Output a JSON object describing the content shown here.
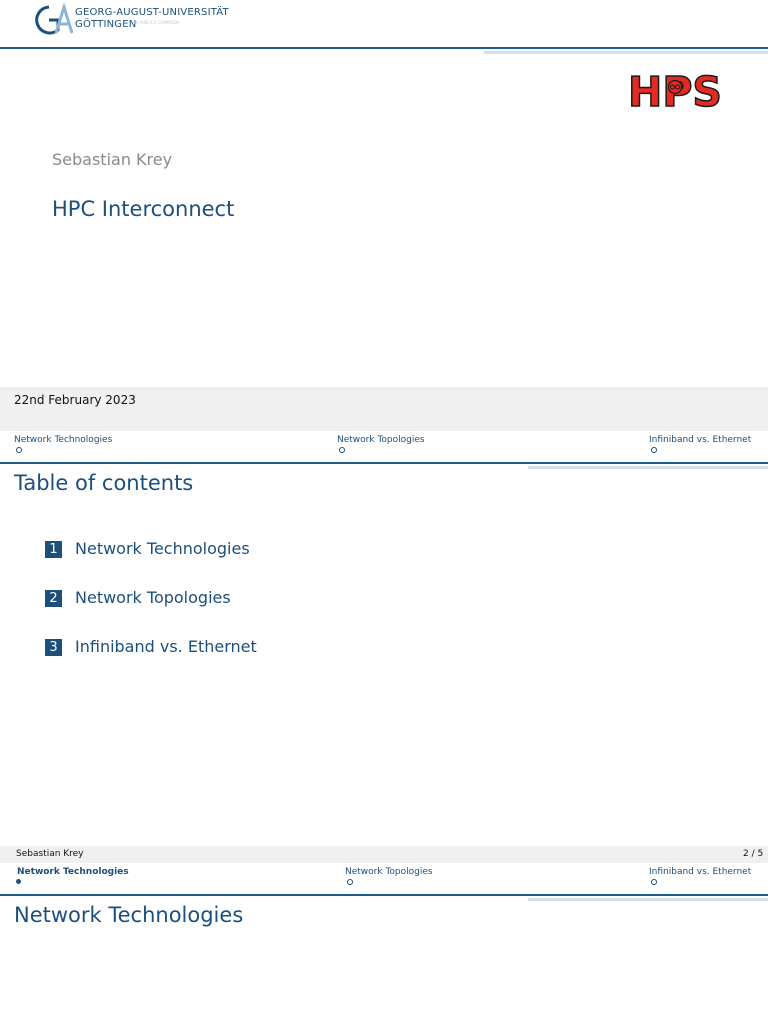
{
  "university": {
    "line1": "GEORG-AUGUST-UNIVERSITÄT",
    "line2": "GÖTTINGEN",
    "tagline": "IN PUBLICA COMMODA"
  },
  "brand_logo": {
    "text": "HPS",
    "colors": {
      "fill": "#e32b24",
      "outline": "#1a1a1a"
    }
  },
  "title_slide": {
    "author": "Sebastian Krey",
    "title": "HPC Interconnect",
    "date": "22nd February 2023"
  },
  "navigation": {
    "sections": [
      "Network Technologies",
      "Network Topologies",
      "Infiniband vs. Ethernet"
    ],
    "active_section": "Network Technologies"
  },
  "toc_slide": {
    "frame_title": "Table of contents",
    "items": [
      {
        "number": "1",
        "label": "Network Technologies"
      },
      {
        "number": "2",
        "label": "Network Topologies"
      },
      {
        "number": "3",
        "label": "Infiniband vs. Ethernet"
      }
    ],
    "footer": {
      "author": "Sebastian Krey",
      "page": "2 / 5"
    }
  },
  "section_slide": {
    "frame_title": "Network Technologies"
  },
  "colors": {
    "primary": "#1d4f7c",
    "rule": "#1d5c8f",
    "rule_light": "#cfe0ee",
    "bar": "#f0f0f0"
  }
}
